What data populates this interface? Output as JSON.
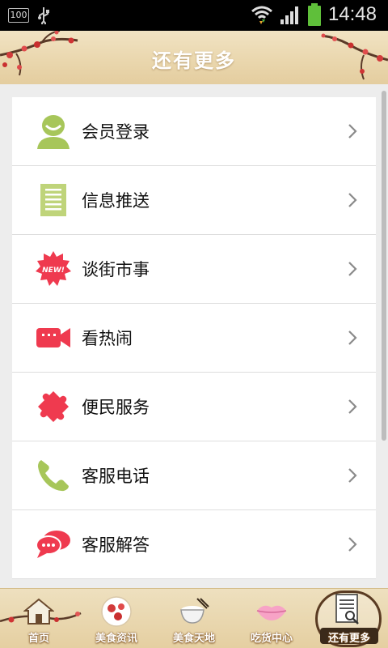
{
  "status_bar": {
    "battery_small": "100",
    "time": "14:48"
  },
  "header": {
    "title": "还有更多"
  },
  "menu": [
    {
      "label": "会员登录",
      "icon": "user-icon"
    },
    {
      "label": "信息推送",
      "icon": "document-icon"
    },
    {
      "label": "谈街市事",
      "icon": "new-badge-icon",
      "badge_text": "NEW!"
    },
    {
      "label": "看热闹",
      "icon": "video-camera-icon"
    },
    {
      "label": "便民服务",
      "icon": "puzzle-icon"
    },
    {
      "label": "客服电话",
      "icon": "phone-icon"
    },
    {
      "label": "客服解答",
      "icon": "chat-bubble-icon"
    }
  ],
  "bottom_nav": [
    {
      "label": "首页",
      "icon": "home-icon"
    },
    {
      "label": "美食资讯",
      "icon": "food-plate-icon"
    },
    {
      "label": "美食天地",
      "icon": "rice-bowl-icon"
    },
    {
      "label": "吃货中心",
      "icon": "lips-icon"
    },
    {
      "label": "还有更多",
      "icon": "more-doc-icon",
      "active": true
    }
  ],
  "colors": {
    "green": "#a7c65a",
    "red": "#ef3a4f",
    "title_bg": "#ead7ae"
  }
}
